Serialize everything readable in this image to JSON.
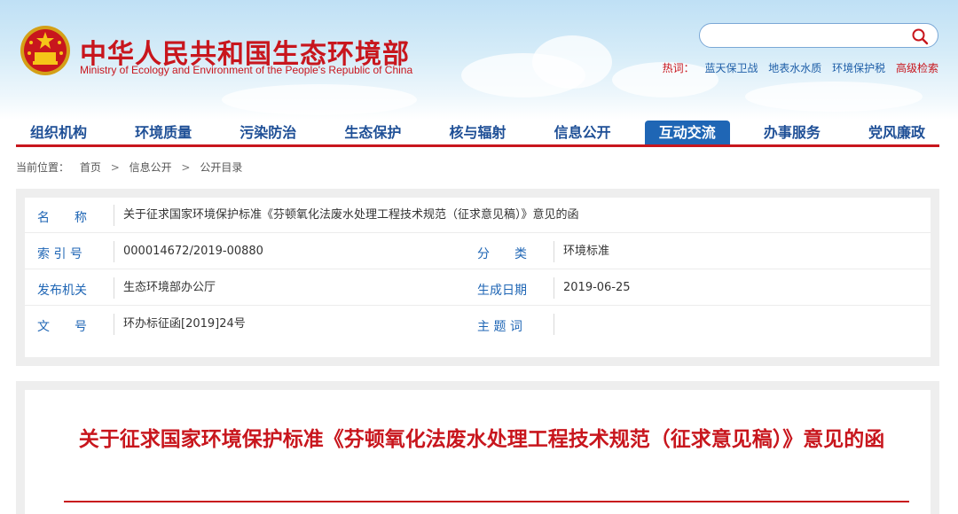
{
  "header": {
    "title": "中华人民共和国生态环境部",
    "subtitle": "Ministry of Ecology and Environment of the People's Republic of China",
    "search": {
      "placeholder": ""
    },
    "hot": {
      "label": "热词：",
      "items": [
        "蓝天保卫战",
        "地表水水质",
        "环境保护税"
      ],
      "advanced": "高级检索"
    }
  },
  "nav": {
    "items": [
      "组织机构",
      "环境质量",
      "污染防治",
      "生态保护",
      "核与辐射",
      "信息公开",
      "互动交流",
      "办事服务",
      "党风廉政"
    ],
    "active_index": 6
  },
  "breadcrumb": {
    "label": "当前位置：",
    "items": [
      "首页",
      "信息公开",
      "公开目录"
    ],
    "separator": ">"
  },
  "info": {
    "name_label": "名　　称",
    "name_value": "关于征求国家环境保护标准《芬顿氧化法废水处理工程技术规范（征求意见稿）》意见的函",
    "index_label": "索 引 号",
    "index_value": "000014672/2019-00880",
    "category_label": "分　　类",
    "category_value": "环境标准",
    "publisher_label": "发布机关",
    "publisher_value": "生态环境部办公厅",
    "date_label": "生成日期",
    "date_value": "2019-06-25",
    "doc_no_label": "文　　号",
    "doc_no_value": "环办标征函[2019]24号",
    "keywords_label": "主 题 词",
    "keywords_value": ""
  },
  "article": {
    "title": "关于征求国家环境保护标准《芬顿氧化法废水处理工程技术规范（征求意见稿）》意见的函"
  },
  "colors": {
    "brand_red": "#c8161d",
    "nav_blue": "#1e4f96",
    "active_blue": "#1f66b5"
  }
}
